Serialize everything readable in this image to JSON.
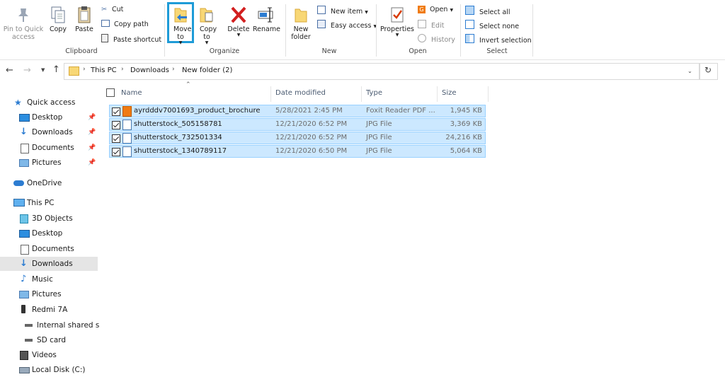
{
  "ribbon": {
    "clipboard": {
      "pin": "Pin to Quick access",
      "copy": "Copy",
      "paste": "Paste",
      "cut": "Cut",
      "copy_path": "Copy path",
      "paste_shortcut": "Paste shortcut",
      "group": "Clipboard"
    },
    "organize": {
      "move_to": "Move to",
      "copy_to": "Copy to",
      "delete": "Delete",
      "rename": "Rename",
      "group": "Organize"
    },
    "new": {
      "new_folder": "New folder",
      "new_item": "New item",
      "easy_access": "Easy access",
      "group": "New"
    },
    "open": {
      "properties": "Properties",
      "open": "Open",
      "edit": "Edit",
      "history": "History",
      "group": "Open"
    },
    "select": {
      "select_all": "Select all",
      "select_none": "Select none",
      "invert": "Invert selection",
      "group": "Select"
    }
  },
  "address": {
    "crumbs": [
      "This PC",
      "Downloads",
      "New folder (2)"
    ]
  },
  "sidebar": {
    "items": [
      {
        "label": "Quick access"
      },
      {
        "label": "Desktop"
      },
      {
        "label": "Downloads"
      },
      {
        "label": "Documents"
      },
      {
        "label": "Pictures"
      },
      {
        "label": "OneDrive"
      },
      {
        "label": "This PC"
      },
      {
        "label": "3D Objects"
      },
      {
        "label": "Desktop"
      },
      {
        "label": "Documents"
      },
      {
        "label": "Downloads"
      },
      {
        "label": "Music"
      },
      {
        "label": "Pictures"
      },
      {
        "label": "Redmi 7A"
      },
      {
        "label": "Internal shared stc"
      },
      {
        "label": "SD card"
      },
      {
        "label": "Videos"
      },
      {
        "label": "Local Disk (C:)"
      }
    ]
  },
  "columns": {
    "name": "Name",
    "date": "Date modified",
    "type": "Type",
    "size": "Size"
  },
  "files": [
    {
      "name": "ayrdddv7001693_product_brochure",
      "date": "5/28/2021 2:45 PM",
      "type": "Foxit Reader PDF ...",
      "size": "1,945 KB"
    },
    {
      "name": "shutterstock_505158781",
      "date": "12/21/2020 6:52 PM",
      "type": "JPG File",
      "size": "3,369 KB"
    },
    {
      "name": "shutterstock_732501334",
      "date": "12/21/2020 6:52 PM",
      "type": "JPG File",
      "size": "24,216 KB"
    },
    {
      "name": "shutterstock_1340789117",
      "date": "12/21/2020 6:50 PM",
      "type": "JPG File",
      "size": "5,064 KB"
    }
  ],
  "colors": {
    "selection": "#cce8ff",
    "highlight_border": "#1e9bd7",
    "folder": "#f8d775"
  }
}
